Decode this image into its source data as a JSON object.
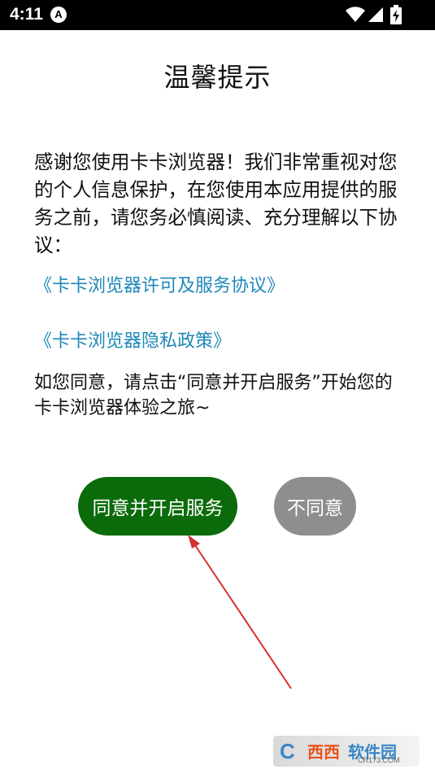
{
  "status_bar": {
    "time": "4:11",
    "app_icon": "A"
  },
  "dialog": {
    "title": "温馨提示",
    "intro": "感谢您使用卡卡浏览器！我们非常重视对您的个人信息保护，在您使用本应用提供的服务之前，请您务必慎阅读、充分理解以下协议：",
    "links": [
      "《卡卡浏览器许可及服务协议》",
      "《卡卡浏览器隐私政策》"
    ],
    "consent": "如您同意，请点击“同意并开启服务”开始您的卡卡浏览器体验之旅~",
    "agree_label": "同意并开启服务",
    "disagree_label": "不同意"
  },
  "watermark": {
    "logo": "C",
    "brand": "西西",
    "soft": "软件园",
    "url": "CR173.COM"
  },
  "colors": {
    "agree_button": "#0b6b0b",
    "disagree_button": "#8e8e8e",
    "link": "#1e88b8",
    "arrow": "#d32f2f"
  }
}
